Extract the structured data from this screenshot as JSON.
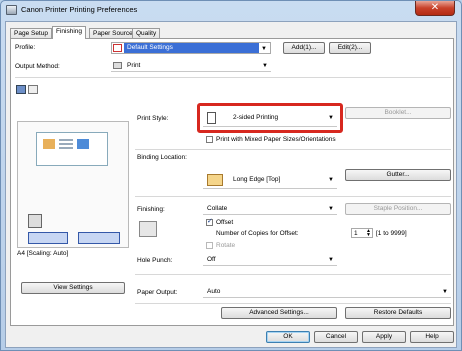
{
  "window": {
    "title": "Canon Printer Printing Preferences",
    "close_glyph": "✕"
  },
  "tabs": [
    {
      "label": "Page Setup"
    },
    {
      "label": "Finishing"
    },
    {
      "label": "Paper Source"
    },
    {
      "label": "Quality"
    }
  ],
  "profile": {
    "label": "Profile:",
    "value": "Default Settings",
    "add_button": "Add(1)...",
    "edit_button": "Edit(2)..."
  },
  "output_method": {
    "label": "Output Method:",
    "value": "Print"
  },
  "preview": {
    "status": "A4 [Scaling: Auto]",
    "view_settings_button": "View Settings"
  },
  "print_style": {
    "label": "Print Style:",
    "value": "2-sided Printing",
    "booklet_button": "Booklet...",
    "mixed_paper_label": "Print with Mixed Paper Sizes/Orientations"
  },
  "binding": {
    "label": "Binding Location:",
    "value": "Long Edge [Top]",
    "gutter_button": "Gutter..."
  },
  "finishing": {
    "label": "Finishing:",
    "value": "Collate",
    "staple_button": "Staple Position...",
    "offset_label": "Offset",
    "copies_label": "Number of Copies for Offset:",
    "copies_value": "1",
    "copies_range": "[1 to 9999]",
    "rotate_label": "Rotate"
  },
  "hole_punch": {
    "label": "Hole Punch:",
    "value": "Off"
  },
  "paper_output": {
    "label": "Paper Output:",
    "value": "Auto"
  },
  "bottom_buttons": {
    "advanced": "Advanced Settings...",
    "restore": "Restore Defaults"
  },
  "dialog_buttons": {
    "ok": "OK",
    "cancel": "Cancel",
    "apply": "Apply",
    "help": "Help"
  },
  "colors": {
    "highlight": "#d7281f",
    "selected_profile": "#3b6fd6",
    "title_bar": "#c9dcf1"
  }
}
